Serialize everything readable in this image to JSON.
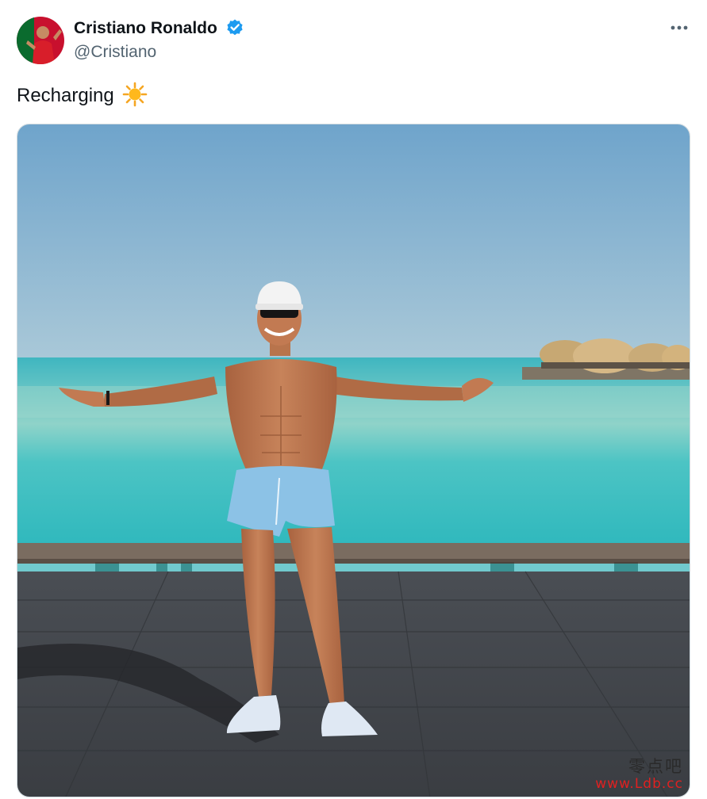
{
  "tweet": {
    "author_name": "Cristiano Ronaldo",
    "author_handle": "@Cristiano",
    "verified": true,
    "text": "Recharging",
    "text_emoji": "sun-icon"
  },
  "icons": {
    "verified": "verified-badge-icon",
    "more": "more-options-icon",
    "sun": "sun-icon"
  },
  "watermark": {
    "chinese": "零点吧",
    "url": "www.Ldb.cc"
  },
  "colors": {
    "verified_blue": "#1d9bf0",
    "handle_gray": "#536471",
    "text": "#0f1419",
    "border": "#cfd9de",
    "watermark_red": "#e02020"
  }
}
